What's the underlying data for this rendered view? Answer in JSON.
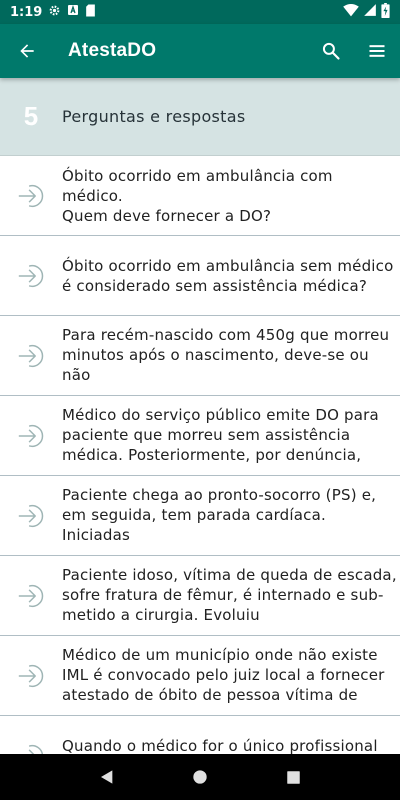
{
  "status_bar": {
    "time": "1:19",
    "left_icons": [
      "settings-icon",
      "a-box-icon",
      "sd-card-icon"
    ],
    "right_icons": [
      "wifi-icon",
      "signal-icon",
      "battery-icon"
    ]
  },
  "app_bar": {
    "title": "AtestaDO",
    "background": "#00796b",
    "status_background": "#00695c",
    "icons": [
      "back-arrow-icon",
      "search-icon",
      "menu-icon"
    ]
  },
  "section": {
    "count": "5",
    "title": "Perguntas e respostas",
    "background": "#d5e3e3"
  },
  "questions": [
    {
      "text": "Óbito ocorrido em ambulância com médico.\nQuem deve fornecer a DO?"
    },
    {
      "text": "Óbito ocorrido em ambulância sem médico\né considerado sem assistência médica?"
    },
    {
      "text": "Para recém-nascido com 450g que morreu\nminutos após o nascimento, deve-se ou não\nemitir a DO? Considera-se óbito fetal?"
    },
    {
      "text": "Médico do serviço público emite DO para\npaciente que morreu sem assistência\nmédica. Posteriormente, por denúncia, sur…"
    },
    {
      "text": "Paciente chega ao pronto-socorro (PS) e,\nem seguida, tem parada cardíaca. Iniciadas\nmanobras de ressuscitação, estas não tê…"
    },
    {
      "text": "Paciente idoso, vítima de queda de escada,\nsofre fratura de fêmur, é internado e sub-\nmetido a cirurgia. Evoluiu adequadamente…"
    },
    {
      "text": "Médico de um município onde não existe\nIML é convocado pelo juiz local a fornecer\natestado de óbito de pessoa vítima de aci…"
    },
    {
      "text": "Quando o médico for o único profissional\nda cidade, é dele a obrigação de emitir a"
    }
  ],
  "list_icon": "arrow-in-circle-icon",
  "nav_bar": {
    "icons": [
      "back-triangle-icon",
      "home-circle-icon",
      "recents-square-icon"
    ]
  }
}
